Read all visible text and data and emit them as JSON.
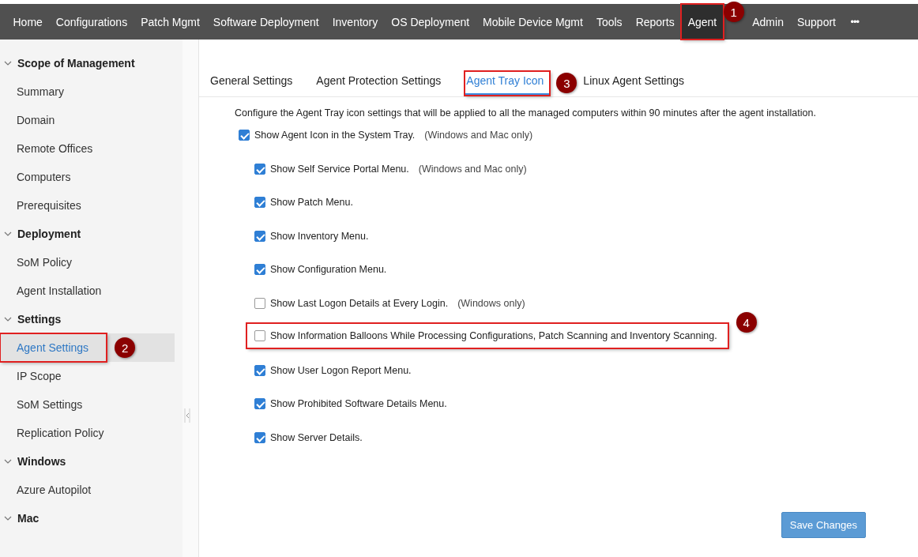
{
  "nav": {
    "items": [
      {
        "label": "Home",
        "selected": false
      },
      {
        "label": "Configurations",
        "selected": false
      },
      {
        "label": "Patch Mgmt",
        "selected": false
      },
      {
        "label": "Software Deployment",
        "selected": false
      },
      {
        "label": "Inventory",
        "selected": false
      },
      {
        "label": "OS Deployment",
        "selected": false
      },
      {
        "label": "Mobile Device Mgmt",
        "selected": false
      },
      {
        "label": "Tools",
        "selected": false
      },
      {
        "label": "Reports",
        "selected": false
      },
      {
        "label": "Agent",
        "selected": true,
        "callout": "1"
      },
      {
        "label": "Admin",
        "selected": false
      },
      {
        "label": "Support",
        "selected": false
      }
    ],
    "more": "•••"
  },
  "sidebar": {
    "sections": [
      {
        "title": "Scope of Management",
        "expanded": true,
        "items": [
          {
            "label": "Summary",
            "selected": false
          },
          {
            "label": "Domain",
            "selected": false
          },
          {
            "label": "Remote Offices",
            "selected": false
          },
          {
            "label": "Computers",
            "selected": false
          },
          {
            "label": "Prerequisites",
            "selected": false
          }
        ]
      },
      {
        "title": "Deployment",
        "expanded": true,
        "items": [
          {
            "label": "SoM Policy",
            "selected": false
          },
          {
            "label": "Agent Installation",
            "selected": false
          }
        ]
      },
      {
        "title": "Settings",
        "expanded": true,
        "items": [
          {
            "label": "Agent Settings",
            "selected": true,
            "callout": "2"
          },
          {
            "label": "IP Scope",
            "selected": false
          },
          {
            "label": "SoM Settings",
            "selected": false
          },
          {
            "label": "Replication Policy",
            "selected": false
          }
        ]
      },
      {
        "title": "Windows",
        "expanded": true,
        "items": [
          {
            "label": "Azure Autopilot",
            "selected": false
          }
        ]
      },
      {
        "title": "Mac",
        "expanded": true
      }
    ]
  },
  "tabs": [
    {
      "label": "General Settings",
      "selected": false
    },
    {
      "label": "Agent Protection Settings",
      "selected": false
    },
    {
      "label": "Agent Tray Icon",
      "selected": true,
      "callout": "3"
    },
    {
      "label": "Linux Agent Settings",
      "selected": false
    }
  ],
  "description": "Configure the Agent Tray icon settings that will be applied to all the managed computers within 90 minutes after the agent installation.",
  "options": [
    {
      "label": "Show Agent Icon in the System Tray.",
      "note": "(Windows and Mac only)",
      "checked": true,
      "children": [
        {
          "label": "Show Self Service Portal Menu.",
          "note": "(Windows and Mac only)",
          "checked": true
        },
        {
          "label": "Show Patch Menu.",
          "checked": true
        },
        {
          "label": "Show Inventory Menu.",
          "checked": true
        },
        {
          "label": "Show Configuration Menu.",
          "checked": true
        },
        {
          "label": "Show Last Logon Details at Every Login.",
          "note": "(Windows only)",
          "checked": false
        },
        {
          "label": "Show Information Balloons While Processing Configurations, Patch Scanning and Inventory Scanning.",
          "checked": false,
          "callout": "4"
        },
        {
          "label": "Show User Logon Report Menu.",
          "checked": true
        },
        {
          "label": "Show Prohibited Software Details Menu.",
          "checked": true
        },
        {
          "label": "Show Server Details.",
          "checked": true
        }
      ]
    }
  ],
  "save_button": "Save Changes"
}
